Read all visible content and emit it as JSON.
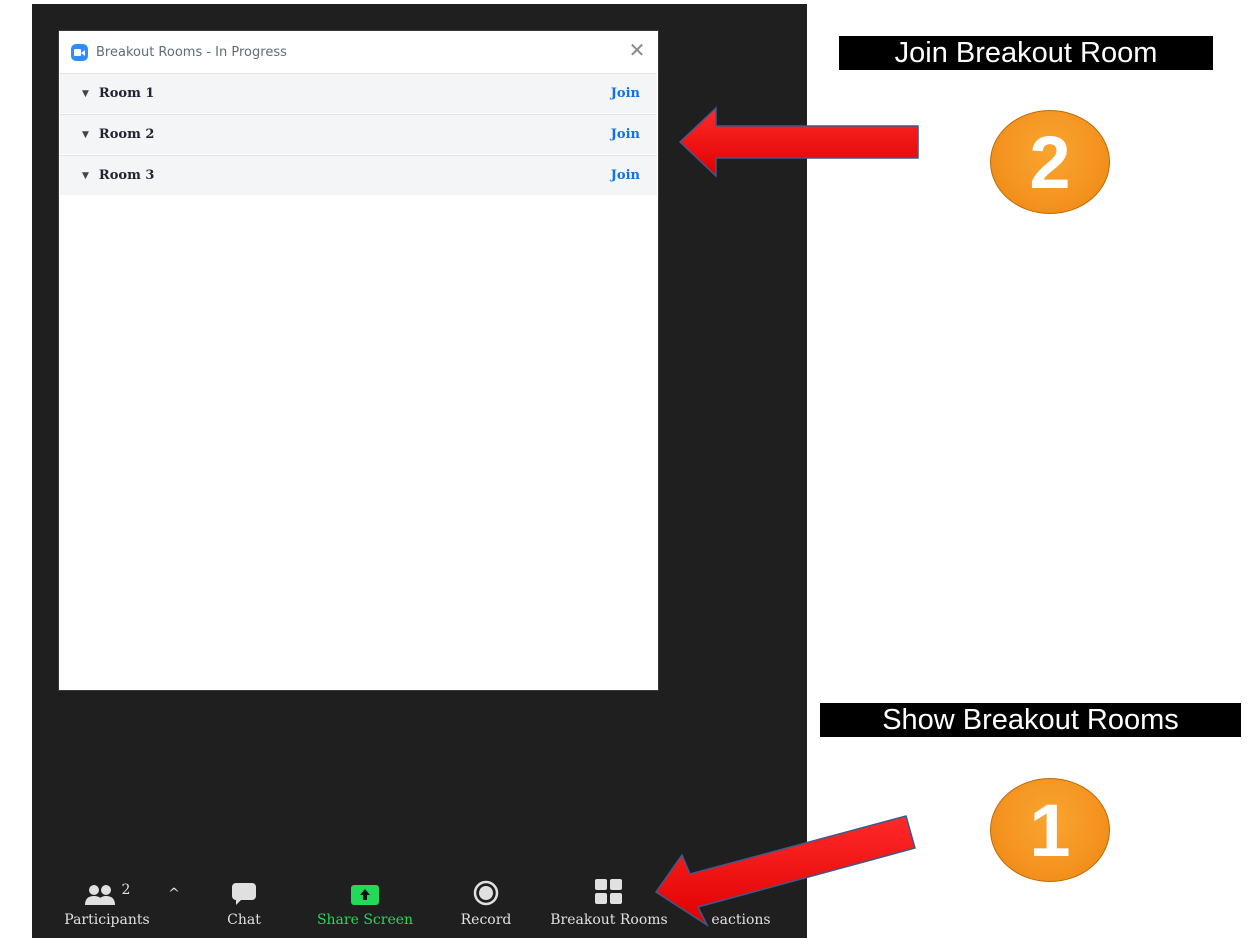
{
  "dialog": {
    "title": "Breakout Rooms - In Progress",
    "close_symbol": "✕",
    "rooms": [
      {
        "name": "Room 1",
        "join_label": "Join"
      },
      {
        "name": "Room 2",
        "join_label": "Join"
      },
      {
        "name": "Room 3",
        "join_label": "Join"
      }
    ]
  },
  "toolbar": {
    "participants_label": "Participants",
    "participants_count": "2",
    "caret_up": "^",
    "chat_label": "Chat",
    "share_label": "Share Screen",
    "record_label": "Record",
    "breakout_label": "Breakout Rooms",
    "reactions_label": "eactions"
  },
  "annotations": {
    "caption_join": "Join Breakout Room",
    "caption_show": "Show Breakout Rooms",
    "badge_join": "2",
    "badge_show": "1"
  },
  "colors": {
    "share_green": "#23d959",
    "join_blue": "#0e72ed",
    "zoom_blue": "#2d8cff",
    "badge_orange": "#f59320",
    "arrow_red": "#ff0000"
  },
  "icons": {
    "participants": "participants-icon",
    "chat": "chat-icon",
    "share": "share-screen-icon",
    "record": "record-icon",
    "breakout": "breakout-rooms-icon"
  }
}
